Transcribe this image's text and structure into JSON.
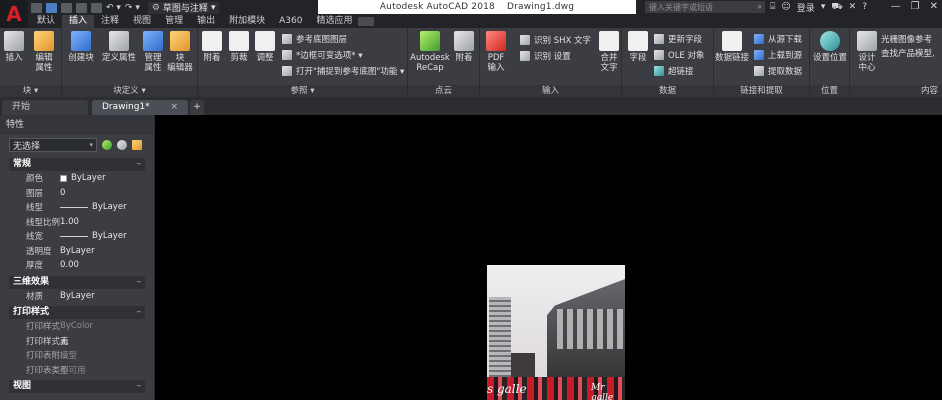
{
  "app": {
    "title": "Autodesk AutoCAD 2018",
    "document": "Drawing1.dwg",
    "logo_letter": "A",
    "workspace": "草图与注释",
    "search_placeholder": "键入关键字或短语",
    "sign_in": "登录",
    "window_controls": [
      "—",
      "❐",
      "✕"
    ]
  },
  "ribbon_tabs": [
    "默认",
    "插入",
    "注释",
    "视图",
    "管理",
    "输出",
    "附加模块",
    "A360",
    "精选应用"
  ],
  "active_tab": "插入",
  "ribbon": {
    "block": {
      "title": "块 ▾",
      "buttons": [
        "插入",
        "编辑\n属性"
      ]
    },
    "block_def": {
      "title": "块定义 ▾",
      "buttons": [
        "创建块",
        "定义属性",
        "管理\n属性",
        "块\n编辑器"
      ]
    },
    "reference": {
      "title": "参照 ▾",
      "buttons": [
        "附着",
        "剪裁",
        "调整"
      ],
      "small": [
        "参考底图图层",
        "*边框可变选项* ▾",
        "打开\"捕捉到参考底图\"功能 ▾"
      ]
    },
    "pointcloud": {
      "title": "点云",
      "buttons": [
        "Autodesk\nReCap",
        "附着"
      ]
    },
    "import": {
      "title": "输入",
      "buttons": [
        "PDF\n输入"
      ],
      "small": [
        "识别 SHX 文字",
        "识别 设置"
      ],
      "more": [
        "合并\n文字"
      ]
    },
    "data": {
      "title": "数据",
      "buttons": [
        "字段"
      ],
      "small": [
        "更新字段",
        "OLE 对象",
        "超链接"
      ]
    },
    "link": {
      "title": "链接和提取",
      "buttons": [
        "数据链接"
      ],
      "small": [
        "从源下载",
        "上载到源",
        "提取数据"
      ]
    },
    "location": {
      "title": "位置",
      "buttons": [
        "设置位置"
      ]
    },
    "content": {
      "title": "内容",
      "buttons": [
        "设计\n中心"
      ],
      "small": [
        "光栅图像参考",
        "查找产品模型,"
      ]
    }
  },
  "doc_tabs": {
    "start": "开始",
    "drawing": "Drawing1*",
    "add": "+"
  },
  "properties": {
    "title": "特性",
    "selection": "无选择",
    "sections": [
      {
        "name": "常规",
        "rows": [
          {
            "k": "颜色",
            "v": "ByLayer",
            "kind": "swatch"
          },
          {
            "k": "图层",
            "v": "0"
          },
          {
            "k": "线型",
            "v": "ByLayer",
            "kind": "line"
          },
          {
            "k": "线型比例",
            "v": "1.00"
          },
          {
            "k": "线宽",
            "v": "ByLayer",
            "kind": "line"
          },
          {
            "k": "透明度",
            "v": "ByLayer"
          },
          {
            "k": "厚度",
            "v": "0.00"
          }
        ]
      },
      {
        "name": "三维效果",
        "rows": [
          {
            "k": "材质",
            "v": "ByLayer"
          }
        ]
      },
      {
        "name": "打印样式",
        "rows": [
          {
            "k": "打印样式",
            "v": "ByColor",
            "dim": true
          },
          {
            "k": "打印样式表",
            "v": "无"
          },
          {
            "k": "打印表附...",
            "v": "模型",
            "dim": true
          },
          {
            "k": "打印表类型",
            "v": "不可用",
            "dim": true
          }
        ]
      },
      {
        "name": "视图",
        "rows": []
      }
    ]
  },
  "image_signs": [
    "s galle",
    "Mr galle"
  ],
  "colors": {
    "accent_red": "#d61f26",
    "panel": "#3b3d42",
    "canvas": "#000000"
  }
}
